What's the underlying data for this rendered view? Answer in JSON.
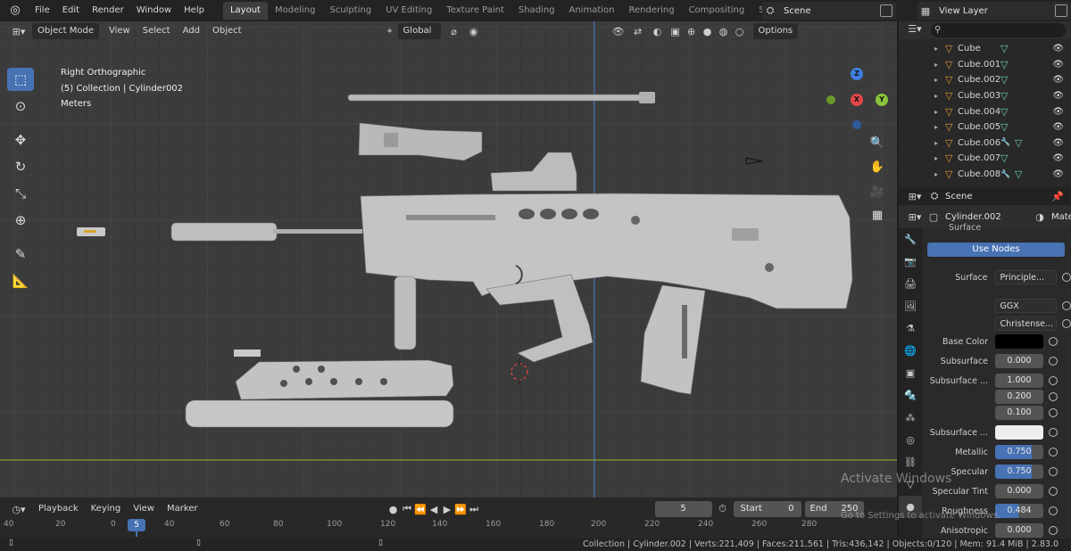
{
  "menu": [
    "File",
    "Edit",
    "Render",
    "Window",
    "Help"
  ],
  "workspaces": [
    "Layout",
    "Modeling",
    "Sculpting",
    "UV Editing",
    "Texture Paint",
    "Shading",
    "Animation",
    "Rendering",
    "Compositing",
    "Scripting"
  ],
  "active_workspace": "Layout",
  "scene_name": "Scene",
  "view_layer": "View Layer",
  "viewport": {
    "mode": "Object Mode",
    "menus": [
      "View",
      "Select",
      "Add",
      "Object"
    ],
    "transform_orientation": "Global",
    "options_label": "Options",
    "overlay_info": [
      "Right Orthographic",
      "(5) Collection | Cylinder002",
      "Meters"
    ],
    "gizmo_labels": {
      "z": "Z",
      "y": "Y",
      "x": "X"
    }
  },
  "outliner": {
    "search_placeholder": "",
    "items": [
      {
        "name": "Cube",
        "has_modifier": false
      },
      {
        "name": "Cube.001",
        "has_modifier": false
      },
      {
        "name": "Cube.002",
        "has_modifier": false
      },
      {
        "name": "Cube.003",
        "has_modifier": false
      },
      {
        "name": "Cube.004",
        "has_modifier": false
      },
      {
        "name": "Cube.005",
        "has_modifier": false
      },
      {
        "name": "Cube.006",
        "has_modifier": true
      },
      {
        "name": "Cube.007",
        "has_modifier": false
      },
      {
        "name": "Cube.008",
        "has_modifier": true
      }
    ]
  },
  "properties": {
    "scene_label": "Scene",
    "object_name": "Cylinder.002",
    "material_label": "Mate",
    "section_label": "Surface",
    "use_nodes_label": "Use Nodes",
    "rows": [
      {
        "label": "Surface",
        "value": "Principle...",
        "kind": "dropdown"
      },
      {
        "label": "",
        "value": "GGX",
        "kind": "dropdown"
      },
      {
        "label": "",
        "value": "Christense...",
        "kind": "dropdown"
      },
      {
        "label": "Base Color",
        "value": "",
        "kind": "color",
        "color": "#000000"
      },
      {
        "label": "Subsurface",
        "value": "0.000",
        "kind": "number"
      },
      {
        "label": "Subsurface ...",
        "value": "1.000",
        "kind": "number"
      },
      {
        "label": "",
        "value": "0.200",
        "kind": "number"
      },
      {
        "label": "",
        "value": "0.100",
        "kind": "number"
      },
      {
        "label": "Subsurface ...",
        "value": "",
        "kind": "color",
        "color": "#eeeeee"
      },
      {
        "label": "Metallic",
        "value": "0.750",
        "kind": "slider",
        "fraction": 0.75
      },
      {
        "label": "Specular",
        "value": "0.750",
        "kind": "slider",
        "fraction": 0.75
      },
      {
        "label": "Specular Tint",
        "value": "0.000",
        "kind": "number"
      },
      {
        "label": "Roughness",
        "value": "0.484",
        "kind": "slider",
        "fraction": 0.484
      },
      {
        "label": "Anisotropic",
        "value": "0.000",
        "kind": "number"
      }
    ]
  },
  "timeline": {
    "menus": [
      "Playback",
      "Keying",
      "View",
      "Marker"
    ],
    "current_frame": "5",
    "start_label": "Start",
    "start_value": "0",
    "end_label": "End",
    "end_value": "250",
    "ruler": [
      "40",
      "20",
      "0",
      "5",
      "40",
      "60",
      "80",
      "100",
      "120",
      "140",
      "160",
      "180",
      "200",
      "220",
      "240",
      "260",
      "280"
    ]
  },
  "status": "Collection | Cylinder.002 | Verts:221,409 | Faces:211,561 | Tris:436,142 | Objects:0/120 | Mem: 91.4 MiB | 2.83.0",
  "watermark": {
    "line1": "Activate Windows",
    "line2": "Go to Settings to activate Windows."
  },
  "colors": {
    "accent": "#4772b3",
    "object_orange": "#e39a38",
    "mesh_green": "#6cd3a4"
  }
}
